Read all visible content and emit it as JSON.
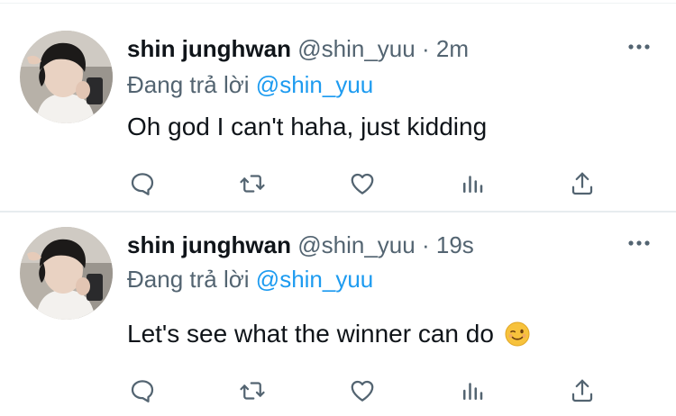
{
  "tweets": [
    {
      "name": "shin junghwan",
      "handle": "@shin_yuu",
      "separator": "·",
      "time": "2m",
      "replying_prefix": "Đang trả lời",
      "replying_to": "@shin_yuu",
      "text": "Oh god I can't haha, just kidding",
      "emoji": ""
    },
    {
      "name": "shin junghwan",
      "handle": "@shin_yuu",
      "separator": "·",
      "time": "19s",
      "replying_prefix": "Đang trả lời",
      "replying_to": "@shin_yuu",
      "text": "Let's see what the winner can do",
      "emoji": "winking-face"
    }
  ],
  "actions": [
    "reply-icon",
    "retweet-icon",
    "like-icon",
    "analytics-icon",
    "share-icon"
  ],
  "colors": {
    "text": "#0f1419",
    "secondary": "#536471",
    "link": "#1d9bf0",
    "divider": "#eff3f4"
  }
}
